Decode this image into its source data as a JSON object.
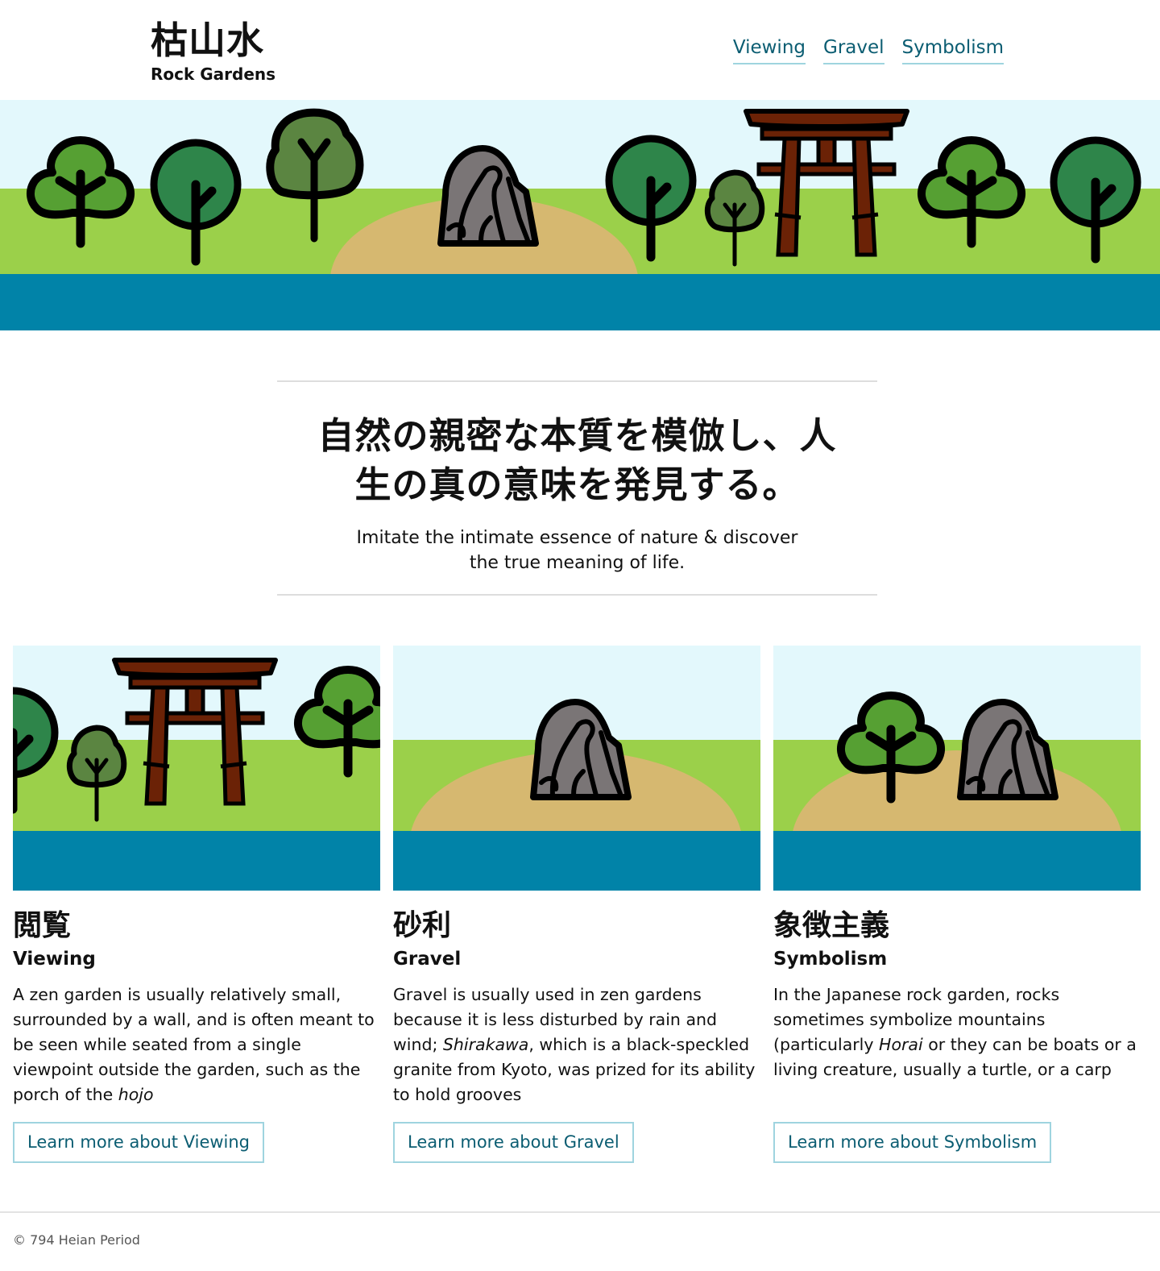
{
  "header": {
    "title_jp": "枯山水",
    "title_en": "Rock Gardens",
    "nav": [
      {
        "label": "Viewing"
      },
      {
        "label": "Gravel"
      },
      {
        "label": "Symbolism"
      }
    ]
  },
  "tagline": {
    "jp": "自然の親密な本質を模倣し、人生の真の意味を発見する。",
    "en": "Imitate the intimate essence of nature & discover the true meaning of life."
  },
  "cards": [
    {
      "title_jp": "閲覧",
      "title_en": "Viewing",
      "text_before": "A zen garden is usually relatively small, surrounded by a wall, and is often meant to be seen while seated from a single viewpoint outside the garden, such as the porch of the ",
      "text_em": "hojo",
      "text_after": "",
      "button": "Learn more about Viewing"
    },
    {
      "title_jp": "砂利",
      "title_en": "Gravel",
      "text_before": "Gravel is usually used in zen gardens because it is less disturbed by rain and wind; ",
      "text_em": "Shirakawa",
      "text_after": ", which is a black-speckled granite from Kyoto, was prized for its ability to hold grooves",
      "button": "Learn more about Gravel"
    },
    {
      "title_jp": "象徴主義",
      "title_en": "Symbolism",
      "text_before": "In the Japanese rock garden, rocks sometimes symbolize mountains (particularly ",
      "text_em": "Horai",
      "text_after": " or they can be boats or a living creature, usually a turtle, or a carp",
      "button": "Learn more about Symbolism"
    }
  ],
  "footer": {
    "text": "© 794 Heian Period"
  },
  "colors": {
    "sky": "#e3f8fc",
    "grass": "#9bd04a",
    "sand": "#d6b870",
    "water": "#0183a8",
    "rock": "#7a7576",
    "torii": "#6b2206",
    "tree_light": "#56a033",
    "tree_dark": "#2e854a",
    "tree_olive": "#5b8541",
    "link": "#0b5d72"
  }
}
